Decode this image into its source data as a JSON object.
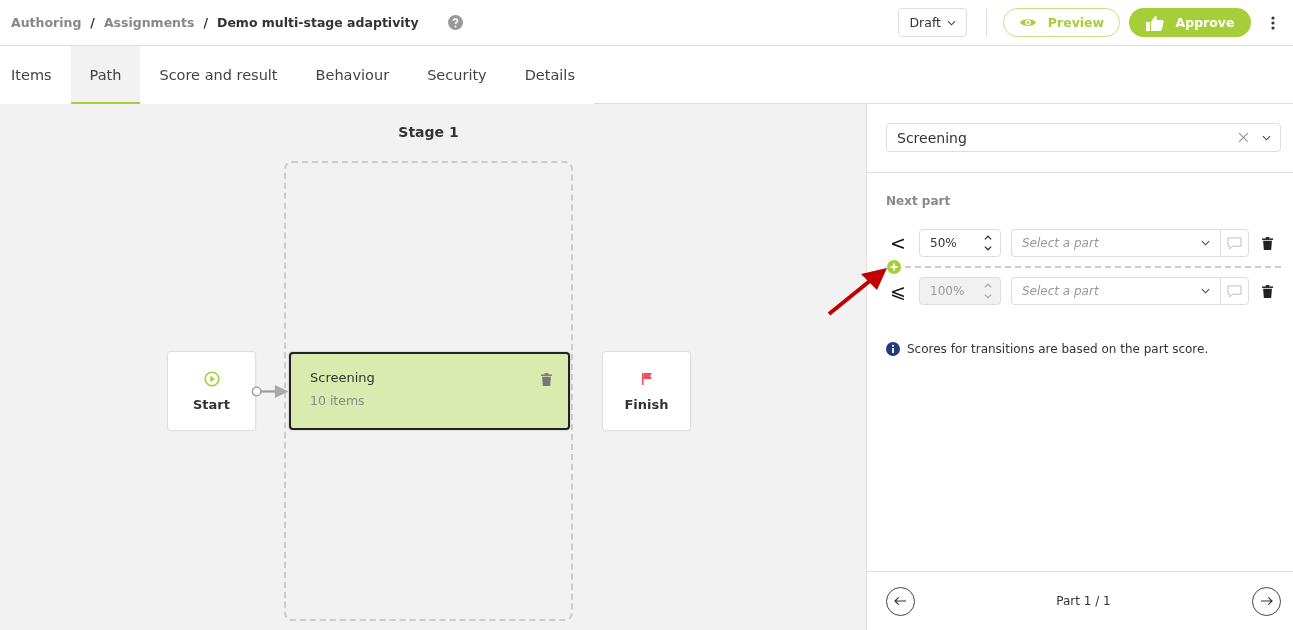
{
  "breadcrumb": [
    {
      "label": "Authoring",
      "current": false
    },
    {
      "label": "Assignments",
      "current": false
    },
    {
      "label": "Demo multi-stage adaptivity",
      "current": true
    }
  ],
  "breadcrumb_separator": "/",
  "header_actions": {
    "status": "Draft",
    "preview": "Preview",
    "approve": "Approve"
  },
  "tabs": [
    {
      "label": "Items",
      "selected": false
    },
    {
      "label": "Path",
      "selected": true
    },
    {
      "label": "Score and result",
      "selected": false
    },
    {
      "label": "Behaviour",
      "selected": false
    },
    {
      "label": "Security",
      "selected": false
    },
    {
      "label": "Details",
      "selected": false
    }
  ],
  "canvas": {
    "stage_title": "Stage 1",
    "nodes": [
      {
        "kind": "start",
        "label": "Start"
      },
      {
        "kind": "part",
        "label": "Screening",
        "detail": "10 items"
      },
      {
        "kind": "finish",
        "label": "Finish"
      }
    ]
  },
  "panel": {
    "part_select": "Screening",
    "section_title": "Next part",
    "transitions": [
      {
        "operator": "<",
        "value": "50%",
        "disabled": false,
        "placeholder": "Select a part"
      },
      {
        "operator": "⩽",
        "value": "100%",
        "disabled": true,
        "placeholder": "Select a part"
      }
    ],
    "info": "Scores for transitions are based on the part score.",
    "pager": "Part 1 / 1"
  }
}
